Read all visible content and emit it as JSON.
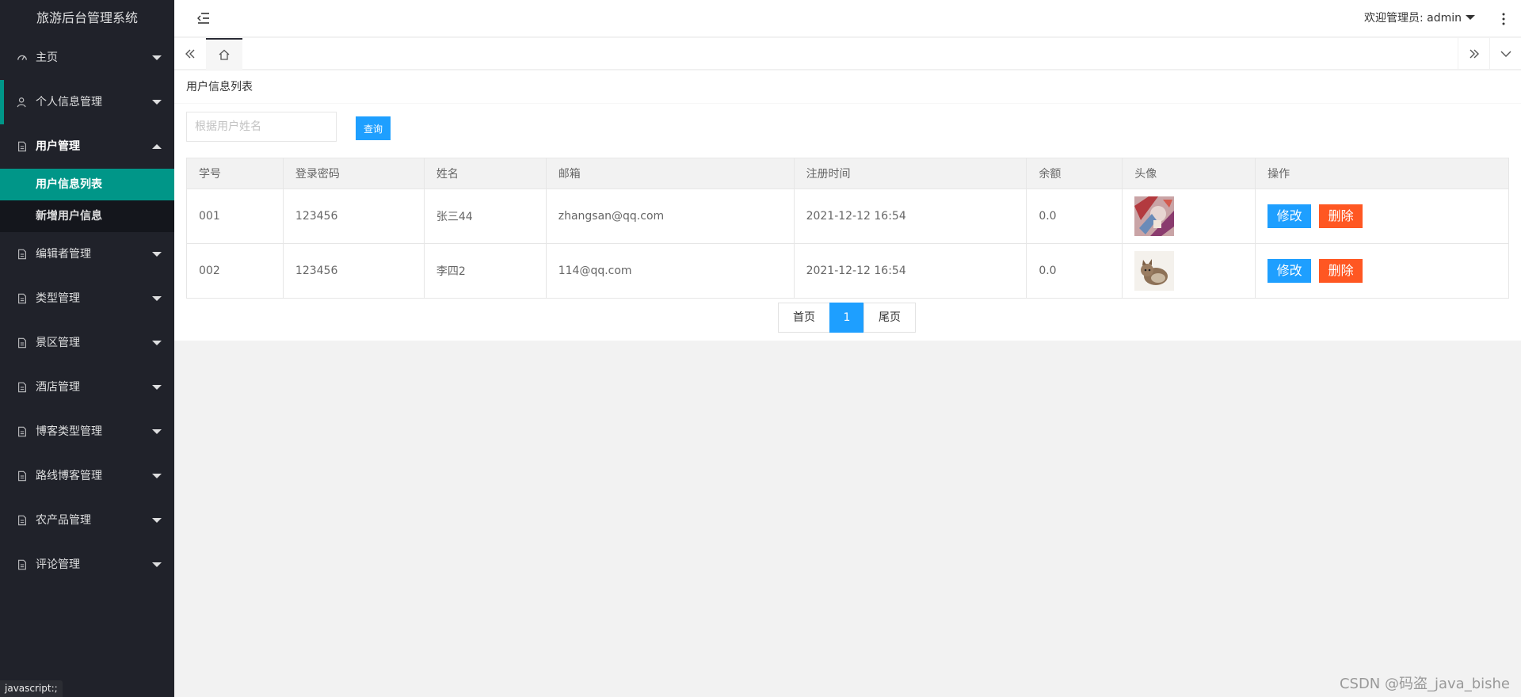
{
  "app": {
    "title": "旅游后台管理系统"
  },
  "sidebar": {
    "items": [
      {
        "label": "主页",
        "icon": "dashboard-icon"
      },
      {
        "label": "个人信息管理",
        "icon": "user-icon"
      },
      {
        "label": "用户管理",
        "icon": "file-icon"
      },
      {
        "label": "编辑者管理",
        "icon": "file-icon"
      },
      {
        "label": "类型管理",
        "icon": "file-icon"
      },
      {
        "label": "景区管理",
        "icon": "file-icon"
      },
      {
        "label": "酒店管理",
        "icon": "file-icon"
      },
      {
        "label": "博客类型管理",
        "icon": "file-icon"
      },
      {
        "label": "路线博客管理",
        "icon": "file-icon"
      },
      {
        "label": "农产品管理",
        "icon": "file-icon"
      },
      {
        "label": "评论管理",
        "icon": "file-icon"
      }
    ],
    "sub_items": [
      {
        "label": "用户信息列表",
        "active": true
      },
      {
        "label": "新增用户信息",
        "active": false
      }
    ]
  },
  "header": {
    "welcome": "欢迎管理员: admin"
  },
  "page": {
    "card_title": "用户信息列表",
    "search": {
      "placeholder": "根据用户姓名",
      "button": "查询"
    }
  },
  "table": {
    "columns": [
      "学号",
      "登录密码",
      "姓名",
      "邮箱",
      "注册时间",
      "余额",
      "头像",
      "操作"
    ],
    "rows": [
      {
        "id": "001",
        "password": "123456",
        "name": "张三44",
        "email": "zhangsan@qq.com",
        "registered": "2021-12-12 16:54",
        "balance": "0.0",
        "avatar": "colorful-photo"
      },
      {
        "id": "002",
        "password": "123456",
        "name": "李四2",
        "email": "114@qq.com",
        "registered": "2021-12-12 16:54",
        "balance": "0.0",
        "avatar": "cat-photo"
      }
    ],
    "edit_label": "修改",
    "delete_label": "删除"
  },
  "pager": {
    "first": "首页",
    "current": "1",
    "last": "尾页"
  },
  "status_tip": "javascript:;",
  "watermark": "CSDN @码盗_java_bishe",
  "colors": {
    "sidebar": "#20222a",
    "accent": "#009688",
    "primary": "#1e9fff",
    "danger": "#ff5722"
  }
}
